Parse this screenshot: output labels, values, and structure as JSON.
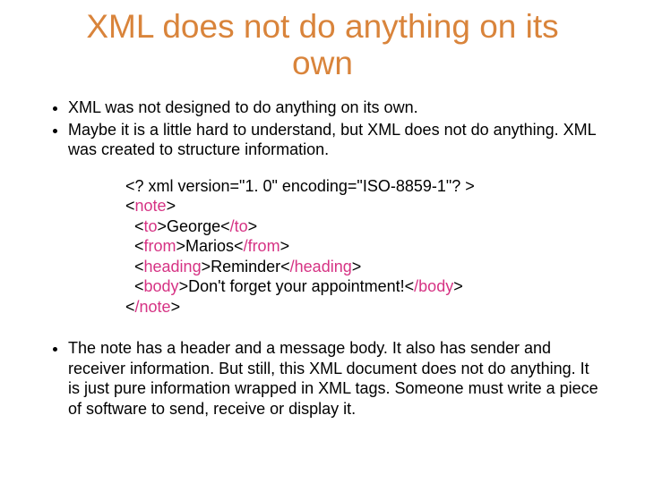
{
  "title": "XML does not do anything on its own",
  "bullets1": {
    "a": "XML was not designed to do anything on its own.",
    "b": "Maybe it is a little hard to understand, but XML does not do anything. XML was created to structure information."
  },
  "code": {
    "l1": "<? xml version=\"1. 0\" encoding=\"ISO-8859-1\"? >",
    "note_open": "note",
    "to_open": "to",
    "to_text": "George",
    "to_close": "/to",
    "from_open": "from",
    "from_text": "Marios",
    "from_close": "/from",
    "heading_open": "heading",
    "heading_text": "Reminder",
    "heading_close": "/heading",
    "body_open": "body",
    "body_text": "Don't forget your appointment!",
    "body_close": "/body",
    "note_close": "/note"
  },
  "bullets2": {
    "a": "The note has a header and a message body. It also has sender and receiver information. But still, this XML document does not do anything. It is just pure information wrapped in XML tags. Someone must write a piece of software to send, receive or display it."
  }
}
